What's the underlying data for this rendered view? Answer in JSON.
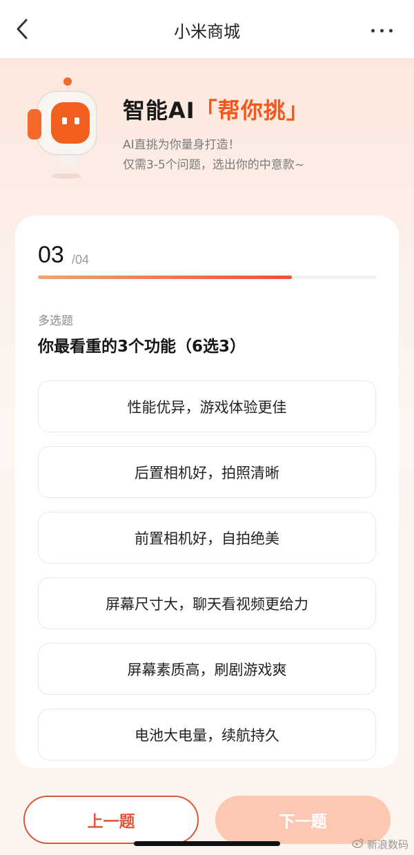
{
  "nav": {
    "title": "小米商城",
    "back_icon": "chevron-left-icon",
    "more_icon": "more-horizontal-icon"
  },
  "hero": {
    "title_main": "智能AI",
    "title_accent": "「帮你挑」",
    "subtitle_line1": "AI直挑为你量身打造！",
    "subtitle_line2": "仅需3-5个问题，选出你的中意款~",
    "accent_color": "#f4561b",
    "mascot_icon": "robot-mascot-icon"
  },
  "progress": {
    "current": "03",
    "total": "/04",
    "fraction": 0.75
  },
  "question": {
    "type": "多选题",
    "text": "你最看重的3个功能（6选3）",
    "options": [
      "性能优异，游戏体验更佳",
      "后置相机好，拍照清晰",
      "前置相机好，自拍绝美",
      "屏幕尺寸大，聊天看视频更给力",
      "屏幕素质高，刷剧游戏爽",
      "电池大电量，续航持久"
    ]
  },
  "footer": {
    "prev_label": "上一题",
    "next_label": "下一题"
  },
  "watermark": {
    "text": "新浪数码",
    "icon": "weibo-icon"
  }
}
